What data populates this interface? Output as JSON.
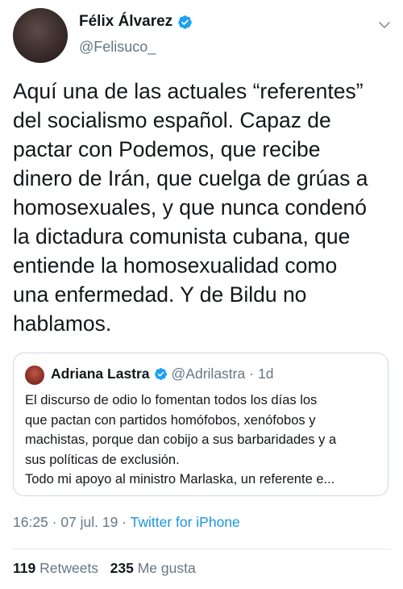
{
  "tweet": {
    "author": {
      "name": "Félix Álvarez",
      "handle": "@Felisuco_"
    },
    "text": "Aquí una de las actuales “referentes”\ndel socialismo español. Capaz de\npactar con Podemos, que recibe\ndinero de Irán, que cuelga de grúas a\nhomosexuales, y que nunca condenó\nla dictadura comunista cubana, que\nentiende la homosexualidad como\nuna enfermedad. Y de Bildu no\nhablamos.",
    "quote": {
      "name": "Adriana Lastra",
      "handle": "@Adrilastra",
      "separator": "·",
      "time": "1d",
      "text": "El discurso de odio lo fomentan todos los días los\nque pactan con partidos homófobos, xenófobos y\nmachistas, porque dan cobijo a sus barbaridades y a\nsus políticas de exclusión.\nTodo mi apoyo al ministro Marlaska, un referente e..."
    },
    "timestamp": "16:25 · 07 jul. 19 · ",
    "source": "Twitter for iPhone",
    "stats": {
      "retweets_count": "119",
      "retweets_label": "Retweets",
      "likes_count": "235",
      "likes_label": "Me gusta"
    }
  },
  "colors": {
    "verified": "#1da1f2",
    "secondary_text": "#657786",
    "link": "#1b95e0",
    "border": "#cfd9de"
  },
  "icons": {
    "verified": "verified-badge-icon",
    "more": "chevron-down-icon"
  }
}
